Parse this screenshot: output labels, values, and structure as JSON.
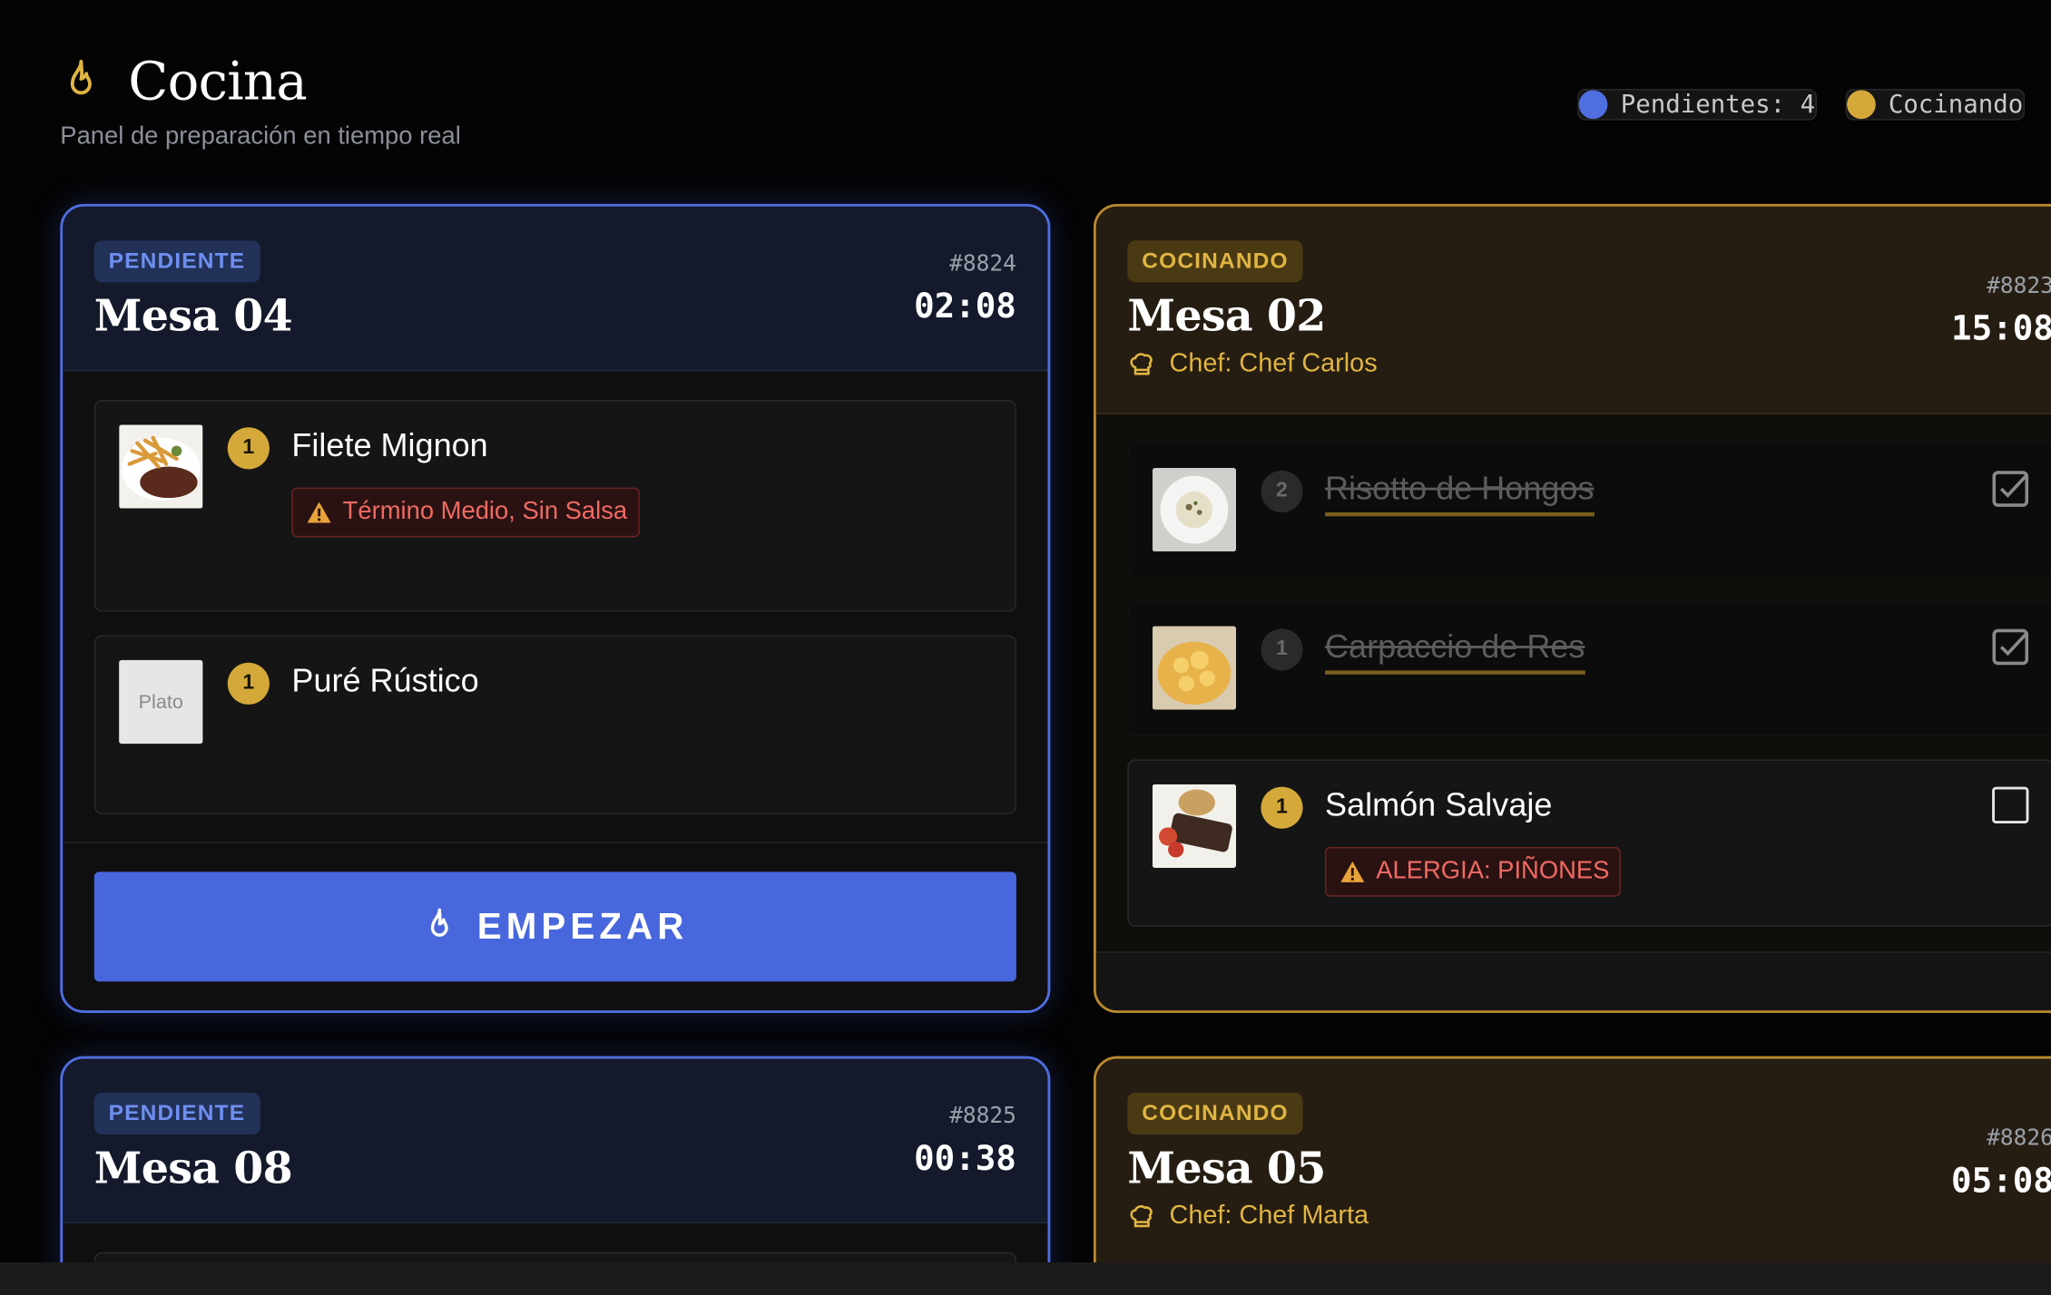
{
  "header": {
    "title": "Cocina",
    "subtitle": "Panel de preparación en tiempo real",
    "legend": {
      "pending": "Pendientes: 4",
      "cooking": "Cocinando"
    }
  },
  "colors": {
    "pending": "#4f6ee0",
    "cooking": "#d4a93a",
    "alert": "#f06a64",
    "button": "#4867dd"
  },
  "orders": [
    {
      "status": "PENDIENTE",
      "mesa": "Mesa 04",
      "number": "#8824",
      "timer": "02:08",
      "items": [
        {
          "qty": "1",
          "name": "Filete Mignon",
          "note": "Término Medio, Sin Salsa",
          "image": "steak-fries-photo"
        },
        {
          "qty": "1",
          "name": "Puré Rústico",
          "image_placeholder": "Plato"
        }
      ],
      "action": "EMPEZAR"
    },
    {
      "status": "COCINANDO",
      "mesa": "Mesa 02",
      "number": "#8823",
      "timer": "15:08",
      "chef": "Chef: Chef Carlos",
      "items": [
        {
          "qty": "2",
          "name": "Risotto de Hongos",
          "done": true,
          "image": "risotto-photo"
        },
        {
          "qty": "1",
          "name": "Carpaccio de Res",
          "done": true,
          "image": "pasta-photo"
        },
        {
          "qty": "1",
          "name": "Salmón Salvaje",
          "done": false,
          "note": "ALERGIA: PIÑONES",
          "image": "grilled-fish-photo"
        }
      ]
    },
    {
      "status": "PENDIENTE",
      "mesa": "Mesa 08",
      "number": "#8825",
      "timer": "00:38"
    },
    {
      "status": "COCINANDO",
      "mesa": "Mesa 05",
      "number": "#8826",
      "timer": "05:08",
      "chef": "Chef: Chef Marta"
    }
  ]
}
